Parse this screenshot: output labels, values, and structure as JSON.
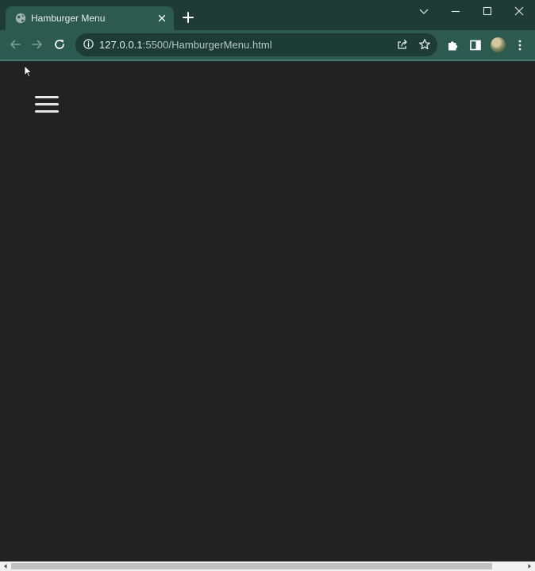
{
  "tab": {
    "title": "Hamburger Menu",
    "favicon_icon": "globe-icon"
  },
  "window_controls": [
    "chevron-down-icon",
    "minimize-icon",
    "maximize-icon",
    "close-icon"
  ],
  "toolbar": {
    "url_host": "127.0.0.1",
    "url_rest": ":5500/HamburgerMenu.html",
    "icons": [
      "back-arrow-icon",
      "forward-arrow-icon",
      "reload-icon",
      "site-info-icon",
      "share-icon",
      "star-icon",
      "puzzle-icon",
      "side-panel-icon",
      "profile-avatar",
      "kebab-menu-icon"
    ]
  },
  "page": {
    "background": "#222222",
    "menu_icon": "hamburger-icon",
    "menu_bar_color": "#e6e6e6"
  },
  "colors": {
    "frame": "#1e3b35",
    "toolbar": "#2c5a4f",
    "omnibox": "#1c3c34"
  }
}
